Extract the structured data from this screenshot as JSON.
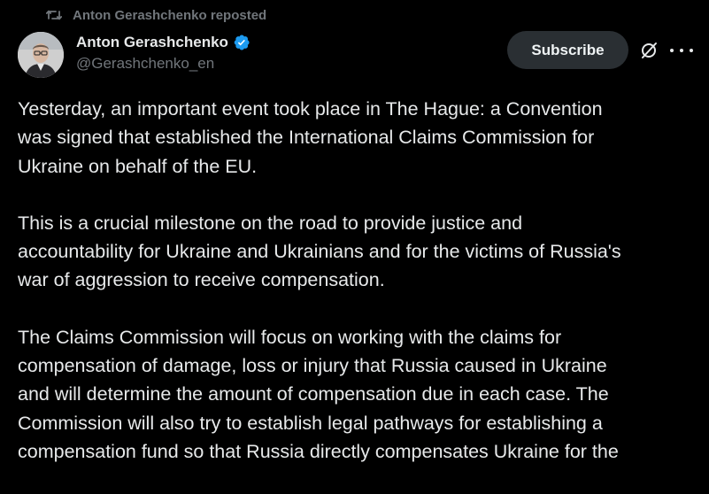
{
  "repost": {
    "icon": "repost-icon",
    "text": "Anton Gerashchenko reposted"
  },
  "author": {
    "name": "Anton Gerashchenko",
    "handle": "@Gerashchenko_en",
    "verified_color": "#1d9bf0"
  },
  "actions": {
    "subscribe_label": "Subscribe",
    "grok_icon": "grok-icon",
    "more_icon": "more-icon"
  },
  "tweet": {
    "paragraphs": [
      [
        "Yesterday, an important event took place in The Hague: a Convention",
        "was signed that established the International Claims Commission for",
        "Ukraine on behalf of the EU."
      ],
      [
        "This is a crucial milestone on the road to provide justice and",
        "accountability for Ukraine and Ukrainians and for the victims of Russia's",
        "war of aggression to receive compensation."
      ],
      [
        "The Claims Commission will focus on working with the claims for",
        "compensation of damage, loss or injury that Russia caused in Ukraine",
        "and will determine the amount of compensation due in each case. The",
        "Commission will also try to establish legal pathways for establishing a",
        "compensation fund so that Russia directly compensates Ukraine for the"
      ]
    ]
  },
  "colors": {
    "background": "#000000",
    "text": "#e7e9ea",
    "secondary": "#71767b",
    "button_bg": "#2a2f33"
  }
}
